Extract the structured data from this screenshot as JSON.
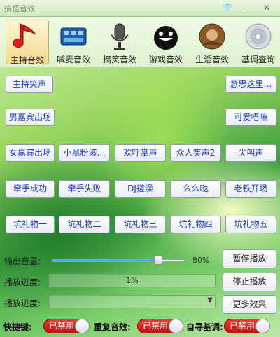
{
  "window": {
    "title": "搞怪音效"
  },
  "tools": [
    {
      "label": "主持音效",
      "icon": "music-note-icon",
      "active": true
    },
    {
      "label": "喊麦音效",
      "icon": "film-reel-icon",
      "active": false
    },
    {
      "label": "搞笑音效",
      "icon": "microphone-icon",
      "active": false
    },
    {
      "label": "游戏音效",
      "icon": "bomb-icon",
      "active": false
    },
    {
      "label": "生活音效",
      "icon": "warrior-icon",
      "active": false
    },
    {
      "label": "基调查询",
      "icon": "cd-disc-icon",
      "active": false
    }
  ],
  "sounds": {
    "r1": [
      "主持笑声",
      "意思这里…"
    ],
    "r2": [
      "男嘉宾出场",
      "可爱唔嘛"
    ],
    "r3": [
      "女嘉宾出场",
      "小黑粉滚…",
      "欢呼掌声",
      "众人笑声2",
      "尖叫声"
    ],
    "r4": [
      "牵手成功",
      "牵手失败",
      "DJ搓澡",
      "么么哒",
      "老铁开场"
    ],
    "r5": [
      "坑礼物一",
      "坑礼物二",
      "坑礼物三",
      "坑礼物四",
      "坑礼物五"
    ]
  },
  "controls": {
    "volume_label": "输出音量:",
    "volume_percent": "80%",
    "volume_value": 0.8,
    "progress_label": "播放进度:",
    "progress_text": "1%",
    "progress_label2": "播放进度:",
    "pause_button": "暂停播放",
    "stop_button": "停止播放",
    "more_button": "更多效果"
  },
  "footer": {
    "hotkey_label": "快捷键:",
    "hotkey_state": "已禁用",
    "repeat_label": "重复音效:",
    "repeat_state": "已禁用",
    "key_label": "自寻基调:",
    "key_state": "已禁用"
  },
  "colors": {
    "accent": "#1b3bb5",
    "toggle_off": "#d91f1f"
  }
}
